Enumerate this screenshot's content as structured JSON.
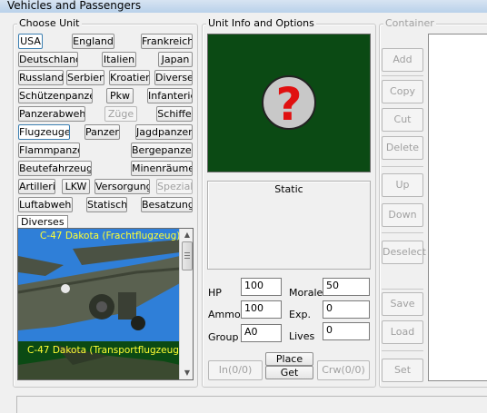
{
  "window": {
    "title": "Vehicles and Passengers"
  },
  "choose_unit": {
    "legend": "Choose Unit",
    "buttons": [
      {
        "label": "USA",
        "state": "selected"
      },
      {
        "label": "England",
        "state": "normal"
      },
      {
        "label": "Frankreich",
        "state": "normal"
      },
      {
        "label": "Deutschland",
        "state": "normal"
      },
      {
        "label": "Italien",
        "state": "normal"
      },
      {
        "label": "Japan",
        "state": "normal"
      },
      {
        "label": "Russland",
        "state": "normal"
      },
      {
        "label": "Serbien",
        "state": "normal"
      },
      {
        "label": "Kroatien",
        "state": "normal"
      },
      {
        "label": "Diverse",
        "state": "normal"
      },
      {
        "label": "Schützenpanzer",
        "state": "normal"
      },
      {
        "label": "Pkw",
        "state": "normal"
      },
      {
        "label": "Infanterie",
        "state": "normal"
      },
      {
        "label": "Panzerabwehr",
        "state": "normal"
      },
      {
        "label": "Züge",
        "state": "disabled"
      },
      {
        "label": "Schiffe",
        "state": "normal"
      },
      {
        "label": "Flugzeuge",
        "state": "selected"
      },
      {
        "label": "Panzer",
        "state": "normal"
      },
      {
        "label": "Jagdpanzer",
        "state": "normal"
      },
      {
        "label": "Flammpanzer",
        "state": "normal"
      },
      {
        "label": "Bergepanzer",
        "state": "normal"
      },
      {
        "label": "Beutefahrzeuge",
        "state": "normal"
      },
      {
        "label": "Minenräumer",
        "state": "normal"
      },
      {
        "label": "Artillerie",
        "state": "normal"
      },
      {
        "label": "LKW",
        "state": "normal"
      },
      {
        "label": "Versorgung",
        "state": "normal"
      },
      {
        "label": "Spezial",
        "state": "disabled"
      },
      {
        "label": "Luftabwehr",
        "state": "normal"
      },
      {
        "label": "Statisch",
        "state": "normal"
      },
      {
        "label": "Besatzung",
        "state": "normal"
      }
    ],
    "diverses_tab": "Diverses",
    "unit_list": [
      {
        "name": "C-47 Dakota (Frachtflugzeug)",
        "text_color": "#ffff33",
        "sky_color": "#2f7fd8"
      },
      {
        "name": "C-47 Dakota (Transportflugzeug)",
        "text_color": "#ffff33",
        "sky_color": "#0b4a14"
      }
    ]
  },
  "unit_info": {
    "legend": "Unit Info and Options",
    "preview_bg": "#0b4a14",
    "preview_icon": "question-mark-icon",
    "description": "Static",
    "hp_label": "HP",
    "hp_value": "100",
    "morale_label": "Morale",
    "morale_value": "50",
    "ammo_label": "Ammo",
    "ammo_value": "100",
    "exp_label": "Exp.",
    "exp_value": "0",
    "group_label": "Group",
    "group_value": "A0",
    "lives_label": "Lives",
    "lives_value": "0",
    "in_button": "In(0/0)",
    "place_button": "Place",
    "get_button": "Get",
    "crw_button": "Crw(0/0)"
  },
  "container": {
    "legend": "Container",
    "buttons": [
      "Add",
      "Copy",
      "Cut",
      "Delete",
      "Up",
      "Down",
      "Deselect",
      "Save",
      "Load",
      "Set"
    ]
  }
}
